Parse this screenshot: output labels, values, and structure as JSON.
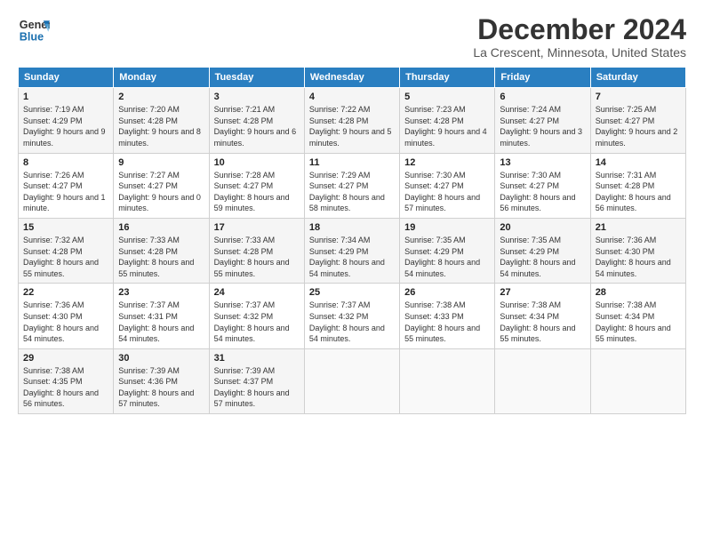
{
  "header": {
    "logo_line1": "General",
    "logo_line2": "Blue",
    "title": "December 2024",
    "subtitle": "La Crescent, Minnesota, United States"
  },
  "columns": [
    "Sunday",
    "Monday",
    "Tuesday",
    "Wednesday",
    "Thursday",
    "Friday",
    "Saturday"
  ],
  "weeks": [
    [
      {
        "day": "1",
        "sunrise": "7:19 AM",
        "sunset": "4:29 PM",
        "daylight": "9 hours and 9 minutes."
      },
      {
        "day": "2",
        "sunrise": "7:20 AM",
        "sunset": "4:28 PM",
        "daylight": "9 hours and 8 minutes."
      },
      {
        "day": "3",
        "sunrise": "7:21 AM",
        "sunset": "4:28 PM",
        "daylight": "9 hours and 6 minutes."
      },
      {
        "day": "4",
        "sunrise": "7:22 AM",
        "sunset": "4:28 PM",
        "daylight": "9 hours and 5 minutes."
      },
      {
        "day": "5",
        "sunrise": "7:23 AM",
        "sunset": "4:28 PM",
        "daylight": "9 hours and 4 minutes."
      },
      {
        "day": "6",
        "sunrise": "7:24 AM",
        "sunset": "4:27 PM",
        "daylight": "9 hours and 3 minutes."
      },
      {
        "day": "7",
        "sunrise": "7:25 AM",
        "sunset": "4:27 PM",
        "daylight": "9 hours and 2 minutes."
      }
    ],
    [
      {
        "day": "8",
        "sunrise": "7:26 AM",
        "sunset": "4:27 PM",
        "daylight": "9 hours and 1 minute."
      },
      {
        "day": "9",
        "sunrise": "7:27 AM",
        "sunset": "4:27 PM",
        "daylight": "9 hours and 0 minutes."
      },
      {
        "day": "10",
        "sunrise": "7:28 AM",
        "sunset": "4:27 PM",
        "daylight": "8 hours and 59 minutes."
      },
      {
        "day": "11",
        "sunrise": "7:29 AM",
        "sunset": "4:27 PM",
        "daylight": "8 hours and 58 minutes."
      },
      {
        "day": "12",
        "sunrise": "7:30 AM",
        "sunset": "4:27 PM",
        "daylight": "8 hours and 57 minutes."
      },
      {
        "day": "13",
        "sunrise": "7:30 AM",
        "sunset": "4:27 PM",
        "daylight": "8 hours and 56 minutes."
      },
      {
        "day": "14",
        "sunrise": "7:31 AM",
        "sunset": "4:28 PM",
        "daylight": "8 hours and 56 minutes."
      }
    ],
    [
      {
        "day": "15",
        "sunrise": "7:32 AM",
        "sunset": "4:28 PM",
        "daylight": "8 hours and 55 minutes."
      },
      {
        "day": "16",
        "sunrise": "7:33 AM",
        "sunset": "4:28 PM",
        "daylight": "8 hours and 55 minutes."
      },
      {
        "day": "17",
        "sunrise": "7:33 AM",
        "sunset": "4:28 PM",
        "daylight": "8 hours and 55 minutes."
      },
      {
        "day": "18",
        "sunrise": "7:34 AM",
        "sunset": "4:29 PM",
        "daylight": "8 hours and 54 minutes."
      },
      {
        "day": "19",
        "sunrise": "7:35 AM",
        "sunset": "4:29 PM",
        "daylight": "8 hours and 54 minutes."
      },
      {
        "day": "20",
        "sunrise": "7:35 AM",
        "sunset": "4:29 PM",
        "daylight": "8 hours and 54 minutes."
      },
      {
        "day": "21",
        "sunrise": "7:36 AM",
        "sunset": "4:30 PM",
        "daylight": "8 hours and 54 minutes."
      }
    ],
    [
      {
        "day": "22",
        "sunrise": "7:36 AM",
        "sunset": "4:30 PM",
        "daylight": "8 hours and 54 minutes."
      },
      {
        "day": "23",
        "sunrise": "7:37 AM",
        "sunset": "4:31 PM",
        "daylight": "8 hours and 54 minutes."
      },
      {
        "day": "24",
        "sunrise": "7:37 AM",
        "sunset": "4:32 PM",
        "daylight": "8 hours and 54 minutes."
      },
      {
        "day": "25",
        "sunrise": "7:37 AM",
        "sunset": "4:32 PM",
        "daylight": "8 hours and 54 minutes."
      },
      {
        "day": "26",
        "sunrise": "7:38 AM",
        "sunset": "4:33 PM",
        "daylight": "8 hours and 55 minutes."
      },
      {
        "day": "27",
        "sunrise": "7:38 AM",
        "sunset": "4:34 PM",
        "daylight": "8 hours and 55 minutes."
      },
      {
        "day": "28",
        "sunrise": "7:38 AM",
        "sunset": "4:34 PM",
        "daylight": "8 hours and 55 minutes."
      }
    ],
    [
      {
        "day": "29",
        "sunrise": "7:38 AM",
        "sunset": "4:35 PM",
        "daylight": "8 hours and 56 minutes."
      },
      {
        "day": "30",
        "sunrise": "7:39 AM",
        "sunset": "4:36 PM",
        "daylight": "8 hours and 57 minutes."
      },
      {
        "day": "31",
        "sunrise": "7:39 AM",
        "sunset": "4:37 PM",
        "daylight": "8 hours and 57 minutes."
      },
      null,
      null,
      null,
      null
    ]
  ]
}
